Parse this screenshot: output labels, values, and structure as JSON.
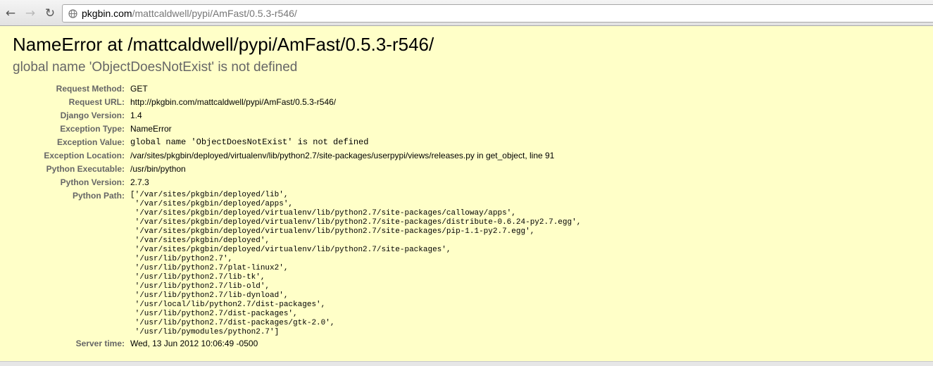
{
  "browser": {
    "url_host": "pkgbin.com",
    "url_path": "/mattcaldwell/pypi/AmFast/0.5.3-r546/",
    "back_icon": "arrow-left-icon",
    "forward_icon": "arrow-right-icon",
    "reload_icon": "reload-icon",
    "page_icon": "globe-icon"
  },
  "error": {
    "title": "NameError at /mattcaldwell/pypi/AmFast/0.5.3-r546/",
    "subtitle": "global name 'ObjectDoesNotExist' is not defined"
  },
  "meta": {
    "request_method": {
      "label": "Request Method:",
      "value": "GET"
    },
    "request_url": {
      "label": "Request URL:",
      "value": "http://pkgbin.com/mattcaldwell/pypi/AmFast/0.5.3-r546/"
    },
    "django_version": {
      "label": "Django Version:",
      "value": "1.4"
    },
    "exception_type": {
      "label": "Exception Type:",
      "value": "NameError"
    },
    "exception_value": {
      "label": "Exception Value:",
      "value": "global name 'ObjectDoesNotExist' is not defined"
    },
    "exception_location": {
      "label": "Exception Location:",
      "value": "/var/sites/pkgbin/deployed/virtualenv/lib/python2.7/site-packages/userpypi/views/releases.py in get_object, line 91"
    },
    "python_executable": {
      "label": "Python Executable:",
      "value": "/usr/bin/python"
    },
    "python_version": {
      "label": "Python Version:",
      "value": "2.7.3"
    },
    "python_path": {
      "label": "Python Path:",
      "lines": [
        "['/var/sites/pkgbin/deployed/lib',",
        " '/var/sites/pkgbin/deployed/apps',",
        " '/var/sites/pkgbin/deployed/virtualenv/lib/python2.7/site-packages/calloway/apps',",
        " '/var/sites/pkgbin/deployed/virtualenv/lib/python2.7/site-packages/distribute-0.6.24-py2.7.egg',",
        " '/var/sites/pkgbin/deployed/virtualenv/lib/python2.7/site-packages/pip-1.1-py2.7.egg',",
        " '/var/sites/pkgbin/deployed',",
        " '/var/sites/pkgbin/deployed/virtualenv/lib/python2.7/site-packages',",
        " '/usr/lib/python2.7',",
        " '/usr/lib/python2.7/plat-linux2',",
        " '/usr/lib/python2.7/lib-tk',",
        " '/usr/lib/python2.7/lib-old',",
        " '/usr/lib/python2.7/lib-dynload',",
        " '/usr/local/lib/python2.7/dist-packages',",
        " '/usr/lib/python2.7/dist-packages',",
        " '/usr/lib/python2.7/dist-packages/gtk-2.0',",
        " '/usr/lib/pymodules/python2.7']"
      ]
    },
    "server_time": {
      "label": "Server time:",
      "value": "Wed, 13 Jun 2012 10:06:49 -0500"
    }
  }
}
